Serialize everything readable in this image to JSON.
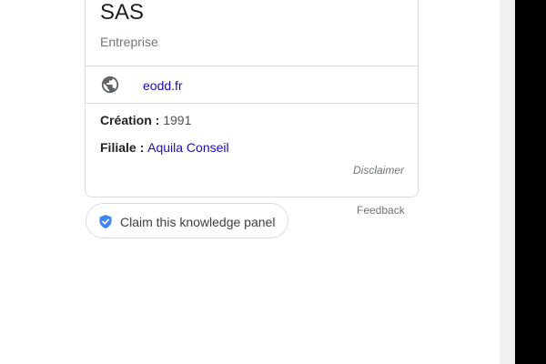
{
  "knowledge_panel": {
    "title": "SAS",
    "subtitle": "Entreprise",
    "website": {
      "icon": "globe-icon",
      "label": "eodd.fr"
    },
    "facts": [
      {
        "label": "Création : ",
        "value": "1991",
        "is_link": false
      },
      {
        "label": "Filiale : ",
        "value": "Aquila Conseil",
        "is_link": true
      }
    ],
    "disclaimer": "Disclaimer"
  },
  "claim_button": {
    "icon": "shield-check-icon",
    "label": "Claim this knowledge panel"
  },
  "feedback_label": "Feedback",
  "colors": {
    "link": "#1a0dab",
    "text_primary": "#202124",
    "text_secondary": "#70757a",
    "border": "#dadce0",
    "shield_blue": "#4285f4",
    "globe_gray": "#5f6368"
  }
}
